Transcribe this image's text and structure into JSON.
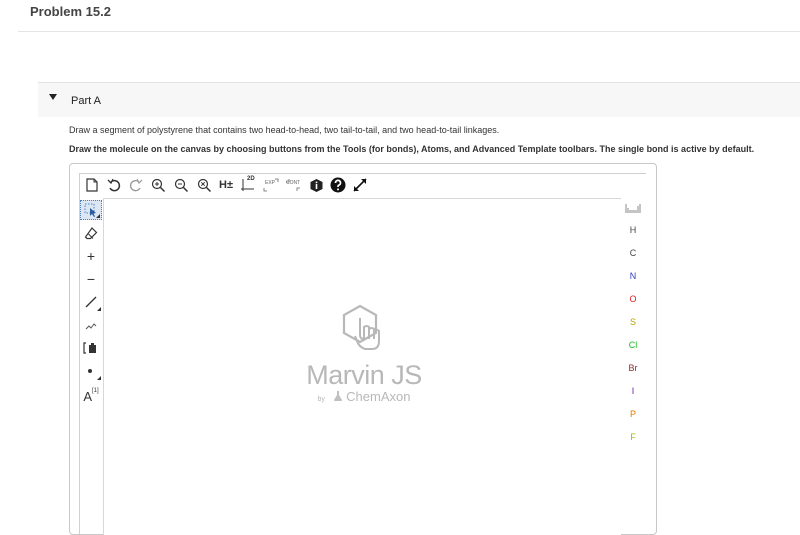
{
  "problem": {
    "title": "Problem 15.2"
  },
  "part": {
    "label": "Part A",
    "instruction": "Draw a segment of polystyrene that contains two head-to-head, two tail-to-tail, and two head-to-tail linkages.",
    "instruction_bold": "Draw the molecule on the canvas by choosing buttons from the Tools (for bonds), Atoms, and Advanced Template toolbars. The single bond is active by default."
  },
  "top_toolbar": {
    "h_explicit_label": "H±",
    "twod_label": "2D",
    "exp_label": "EXP",
    "cont_label": "CONT"
  },
  "left_toolbar": {
    "text_tool_label": "A",
    "text_tool_superscript": "[1]"
  },
  "atoms": [
    {
      "symbol": "H",
      "color": "#444444"
    },
    {
      "symbol": "C",
      "color": "#444444"
    },
    {
      "symbol": "N",
      "color": "#2a3cc8"
    },
    {
      "symbol": "O",
      "color": "#e02020"
    },
    {
      "symbol": "S",
      "color": "#b8a000"
    },
    {
      "symbol": "Cl",
      "color": "#1fb81f"
    },
    {
      "symbol": "Br",
      "color": "#8b2a2a"
    },
    {
      "symbol": "I",
      "color": "#6a1fa8"
    },
    {
      "symbol": "P",
      "color": "#e07a00"
    },
    {
      "symbol": "F",
      "color": "#a8b800"
    }
  ],
  "logo": {
    "name": "Marvin JS",
    "by": "by",
    "company": "ChemAxon"
  }
}
